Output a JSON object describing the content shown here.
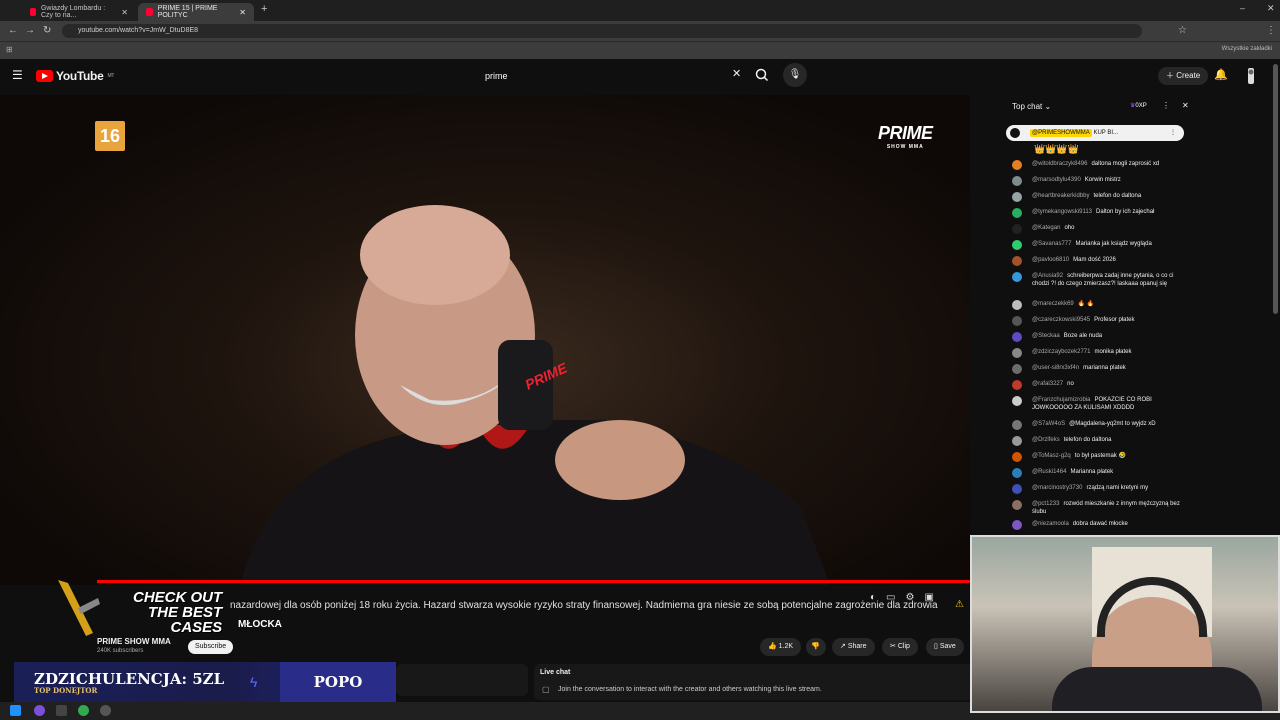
{
  "browser": {
    "tabs": [
      {
        "title": "Gwiazdy Lombardu : Czy to na...",
        "active": false
      },
      {
        "title": "PRIME 15 | PRIME POLITYC",
        "active": true
      }
    ],
    "url": "youtube.com/watch?v=JmW_DtuD8E8",
    "bookmarks_label": "Wszystkie zakładki"
  },
  "youtube": {
    "logo_text": "YouTube",
    "logo_region": "MT",
    "search_value": "prime",
    "create_label": "Create"
  },
  "video": {
    "age_rating": "16",
    "broadcaster_logo": "PRIME",
    "broadcaster_logo_sub": "SHOW MMA",
    "warning_text": "nazardowej dla osób poniżej 18 roku życia. Hazard stwarza wysokie ryzyko straty finansowej. Nadmierna gra niesie ze sobą potencjalne zagrożenie dla zdrowia",
    "lower_third": "MŁOCKA",
    "promo_line1": "CHECK OUT",
    "promo_line2": "THE BEST",
    "promo_line3": "CASES"
  },
  "channel": {
    "name": "PRIME SHOW MMA",
    "subscribers": "240K subscribers",
    "subscribe_label": "Subscribe"
  },
  "actions": {
    "likes": "1.2K",
    "share": "Share",
    "clip": "Clip",
    "save": "Save"
  },
  "overlay": {
    "donator_text": "ZDZICHULENCJA: 5ZL",
    "donator_sub": "TOP DONEJTOR",
    "popo": "POPO"
  },
  "livechat_panel": {
    "title": "Live chat",
    "subtitle": "Join the conversation to interact with the creator and others watching this live stream."
  },
  "chat": {
    "mode": "Top chat",
    "points": "0XP",
    "pinned_author": "@PRIMESHOWMMA",
    "pinned_text": "KUP BI...",
    "messages": [
      {
        "author": "@witoldbraczyk8496",
        "text": "daltona mogli zaprosić xd",
        "color": "#e67e22"
      },
      {
        "author": "@marsodtylu4390",
        "text": "Korwin mistrz",
        "color": "#7f8c8d"
      },
      {
        "author": "@heartbreakerkidbby",
        "text": "telefon do daltona",
        "color": "#95a5a6"
      },
      {
        "author": "@tymekangowski9113",
        "text": "Dalton by ich zajechał",
        "color": "#27ae60"
      },
      {
        "author": "@Kategan",
        "text": "oho",
        "color": "#222222"
      },
      {
        "author": "@Savanas777",
        "text": "Marianka jak ksiądz wygląda",
        "color": "#2ecc71"
      },
      {
        "author": "@pavloo6810",
        "text": "Mam dość 2026",
        "color": "#a0522d"
      },
      {
        "author": "@Anusia92",
        "text": "schreiberpwa zadaj inne pytania, o co ci chodzi ?! do czego zmierzasz?! laskaaa opanuj się",
        "color": "#3498db"
      },
      {
        "author": "@mareczekk69",
        "text": "🔥 🔥",
        "color": "#bdbdbd"
      },
      {
        "author": "@czareczkowski9545",
        "text": "Profesor płatek",
        "color": "#555555"
      },
      {
        "author": "@Steckaa",
        "text": "Boze ale nuda",
        "color": "#5b4bc4"
      },
      {
        "author": "@zdziczaybozek2771",
        "text": "monika płatek",
        "color": "#888888"
      },
      {
        "author": "@user-si8rx3xf4n",
        "text": "marianna platek",
        "color": "#6c6c6c"
      },
      {
        "author": "@rafal3227",
        "text": "no",
        "color": "#c0392b"
      },
      {
        "author": "@Franzchujamizrobia",
        "text": "POKAZCIE CO ROBI JOWKOOOOO ZA KULISAMI XDDDD",
        "color": "#cccccc"
      },
      {
        "author": "@S7aW4oS",
        "text": "@Magdalena-yq2mt to wyjdz xD",
        "color": "#777777"
      },
      {
        "author": "@Drzlfeks",
        "text": "telefon do daltona",
        "color": "#999999"
      },
      {
        "author": "@ToMasz-g2q",
        "text": "to był pastemak 🤣",
        "color": "#d35400"
      },
      {
        "author": "@Ruski1464",
        "text": "Marianna płatek",
        "color": "#2980b9"
      },
      {
        "author": "@marcinostry3730",
        "text": "rządzą nami kretyni my",
        "color": "#3f51b5"
      },
      {
        "author": "@pct1233",
        "text": "rozwód mieszkanie z innym mężczyzną bez ślubu",
        "color": "#8d6e63"
      },
      {
        "author": "@niezamoola",
        "text": "dobra dawać młocke",
        "color": "#7e57c2"
      }
    ]
  }
}
